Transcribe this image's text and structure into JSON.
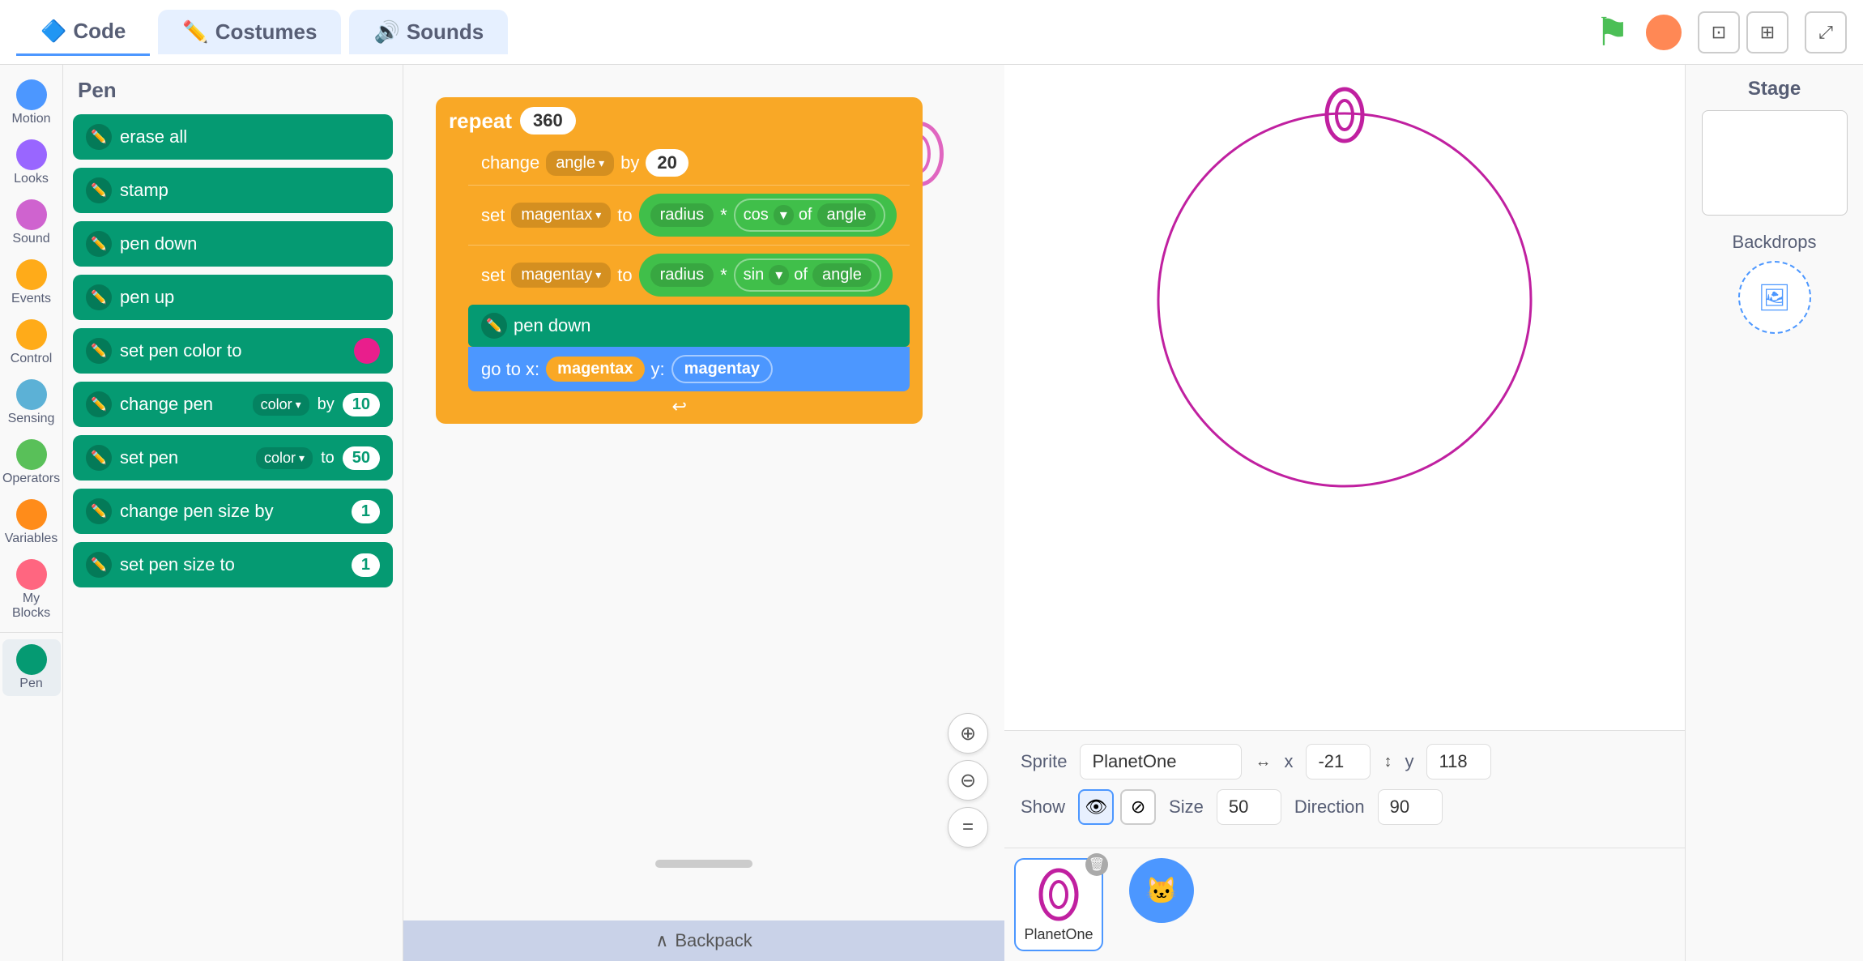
{
  "topbar": {
    "code_tab": "Code",
    "costumes_tab": "Costumes",
    "sounds_tab": "Sounds"
  },
  "categories": [
    {
      "id": "motion",
      "label": "Motion",
      "color": "#4c97ff"
    },
    {
      "id": "looks",
      "label": "Looks",
      "color": "#9966ff"
    },
    {
      "id": "sound",
      "label": "Sound",
      "color": "#cf63cf"
    },
    {
      "id": "events",
      "label": "Events",
      "color": "#ffab19"
    },
    {
      "id": "control",
      "label": "Control",
      "color": "#ffab19"
    },
    {
      "id": "sensing",
      "label": "Sensing",
      "color": "#5cb1d6"
    },
    {
      "id": "operators",
      "label": "Operators",
      "color": "#59c059"
    },
    {
      "id": "variables",
      "label": "Variables",
      "color": "#ff8c1a"
    },
    {
      "id": "myblocks",
      "label": "My Blocks",
      "color": "#ff6680"
    },
    {
      "id": "pen",
      "label": "Pen",
      "color": "#059a72",
      "active": true
    }
  ],
  "blocks_title": "Pen",
  "blocks": [
    {
      "label": "erase all",
      "has_icon": true
    },
    {
      "label": "stamp",
      "has_icon": true
    },
    {
      "label": "pen down",
      "has_icon": true
    },
    {
      "label": "pen up",
      "has_icon": true
    },
    {
      "label": "set pen color to",
      "has_color": true
    },
    {
      "label": "change pen",
      "dropdown": "color",
      "suffix": "by",
      "pill": "10"
    },
    {
      "label": "set pen",
      "dropdown": "color",
      "suffix": "to",
      "pill": "50"
    },
    {
      "label": "change pen size by",
      "pill": "1"
    },
    {
      "label": "set pen size to",
      "pill": "1"
    }
  ],
  "script": {
    "repeat_label": "repeat",
    "repeat_count": "360",
    "change_label": "change",
    "angle_label": "angle",
    "by_label": "by",
    "by_val": "20",
    "set1_label": "set",
    "set1_var": "magentax",
    "set1_to": "to",
    "mul1_label": "radius",
    "mul1_op": "*",
    "cos_label": "cos",
    "of1_label": "of",
    "angle1_label": "angle",
    "set2_label": "set",
    "set2_var": "magentay",
    "set2_to": "to",
    "mul2_label": "radius",
    "mul2_op": "*",
    "sin_label": "sin",
    "of2_label": "of",
    "angle2_label": "angle",
    "pendown_label": "pen down",
    "goto_label": "go to x:",
    "goto_x_var": "magentax",
    "goto_y_label": "y:",
    "goto_y_var": "magentay"
  },
  "sprite_info": {
    "sprite_label": "Sprite",
    "sprite_name": "PlanetOne",
    "x_label": "x",
    "x_val": "-21",
    "y_label": "y",
    "y_val": "118",
    "show_label": "Show",
    "size_label": "Size",
    "size_val": "50",
    "direction_label": "Direction",
    "direction_val": "90"
  },
  "sprite_thumb": {
    "name": "PlanetOne"
  },
  "stage_panel": {
    "title": "Stage",
    "backdrops_label": "Backdrops"
  },
  "zoom": {
    "in": "+",
    "out": "−",
    "reset": "="
  },
  "backpack": "Backpack"
}
